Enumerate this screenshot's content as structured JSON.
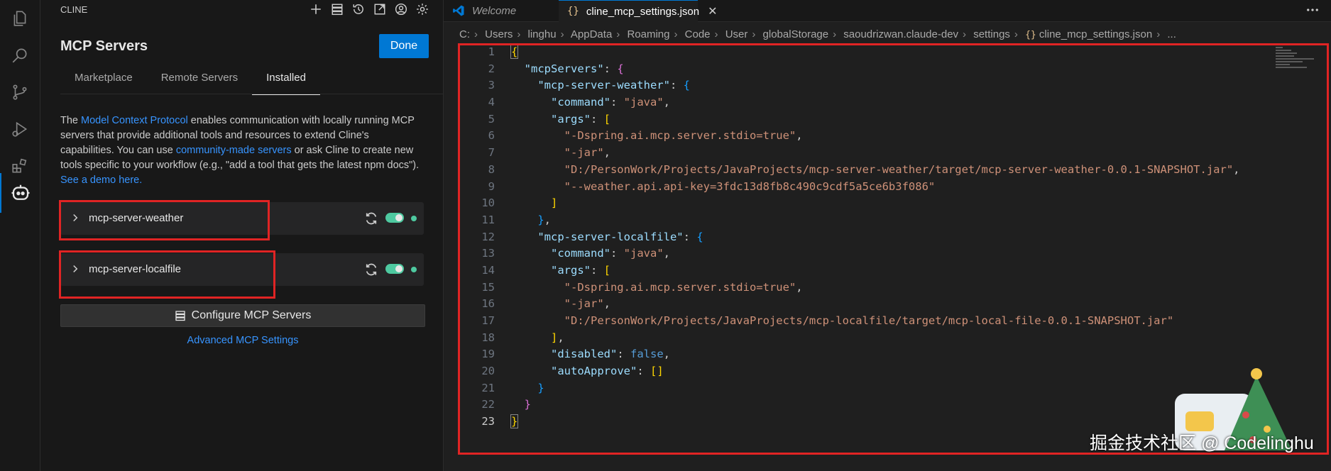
{
  "activity_bar": {
    "items": [
      "explorer-icon",
      "search-icon",
      "source-control-icon",
      "run-debug-icon",
      "extensions-icon",
      "cline-robot-icon"
    ]
  },
  "sidebar": {
    "panel_title": "CLINE",
    "header_icons": [
      "plus-icon",
      "server-stack-icon",
      "history-icon",
      "popout-icon",
      "account-icon",
      "settings-gear-icon"
    ],
    "title": "MCP Servers",
    "done_label": "Done",
    "tabs": [
      {
        "label": "Marketplace",
        "active": false
      },
      {
        "label": "Remote Servers",
        "active": false
      },
      {
        "label": "Installed",
        "active": true
      }
    ],
    "description": {
      "t1": "The ",
      "link1": "Model Context Protocol",
      "t2": " enables communication with locally running MCP servers that provide additional tools and resources to extend Cline's capabilities. You can use ",
      "link2": "community-made servers",
      "t3": " or ask Cline to create new tools specific to your workflow (e.g., \"add a tool that gets the latest npm docs\"). ",
      "link3": "See a demo here."
    },
    "servers": [
      {
        "name": "mcp-server-weather",
        "enabled": true,
        "status_color": "#4ec9a0"
      },
      {
        "name": "mcp-server-localfile",
        "enabled": true,
        "status_color": "#4ec9a0"
      }
    ],
    "configure_label": "Configure MCP Servers",
    "advanced_label": "Advanced MCP Settings"
  },
  "editor": {
    "tabs": [
      {
        "label": "Welcome",
        "active": false
      },
      {
        "label": "cline_mcp_settings.json",
        "active": true
      }
    ],
    "breadcrumb": [
      "C:",
      "Users",
      "linghu",
      "AppData",
      "Roaming",
      "Code",
      "User",
      "globalStorage",
      "saoudrizwan.claude-dev",
      "settings",
      "cline_mcp_settings.json",
      "..."
    ],
    "code": {
      "l2_key": "\"mcpServers\"",
      "l3_key": "\"mcp-server-weather\"",
      "l4_key": "\"command\"",
      "l4_val": "\"java\"",
      "l5_key": "\"args\"",
      "l6_val": "\"-Dspring.ai.mcp.server.stdio=true\"",
      "l7_val": "\"-jar\"",
      "l8_val": "\"D:/PersonWork/Projects/JavaProjects/mcp-server-weather/target/mcp-server-weather-0.0.1-SNAPSHOT.jar\"",
      "l9_val": "\"--weather.api.api-key=3fdc13d8fb8c490c9cdf5a5ce6b3f086\"",
      "l12_key": "\"mcp-server-localfile\"",
      "l13_key": "\"command\"",
      "l13_val": "\"java\"",
      "l14_key": "\"args\"",
      "l15_val": "\"-Dspring.ai.mcp.server.stdio=true\"",
      "l16_val": "\"-jar\"",
      "l17_val": "\"D:/PersonWork/Projects/JavaProjects/mcp-localfile/target/mcp-local-file-0.0.1-SNAPSHOT.jar\"",
      "l19_key": "\"disabled\"",
      "l19_val": "false",
      "l20_key": "\"autoApprove\""
    }
  },
  "watermark": "掘金技术社区 @ Codelinghu",
  "colors": {
    "accent": "#0078d4",
    "highlight_box": "#e02424",
    "status_on": "#4ec9a0"
  }
}
